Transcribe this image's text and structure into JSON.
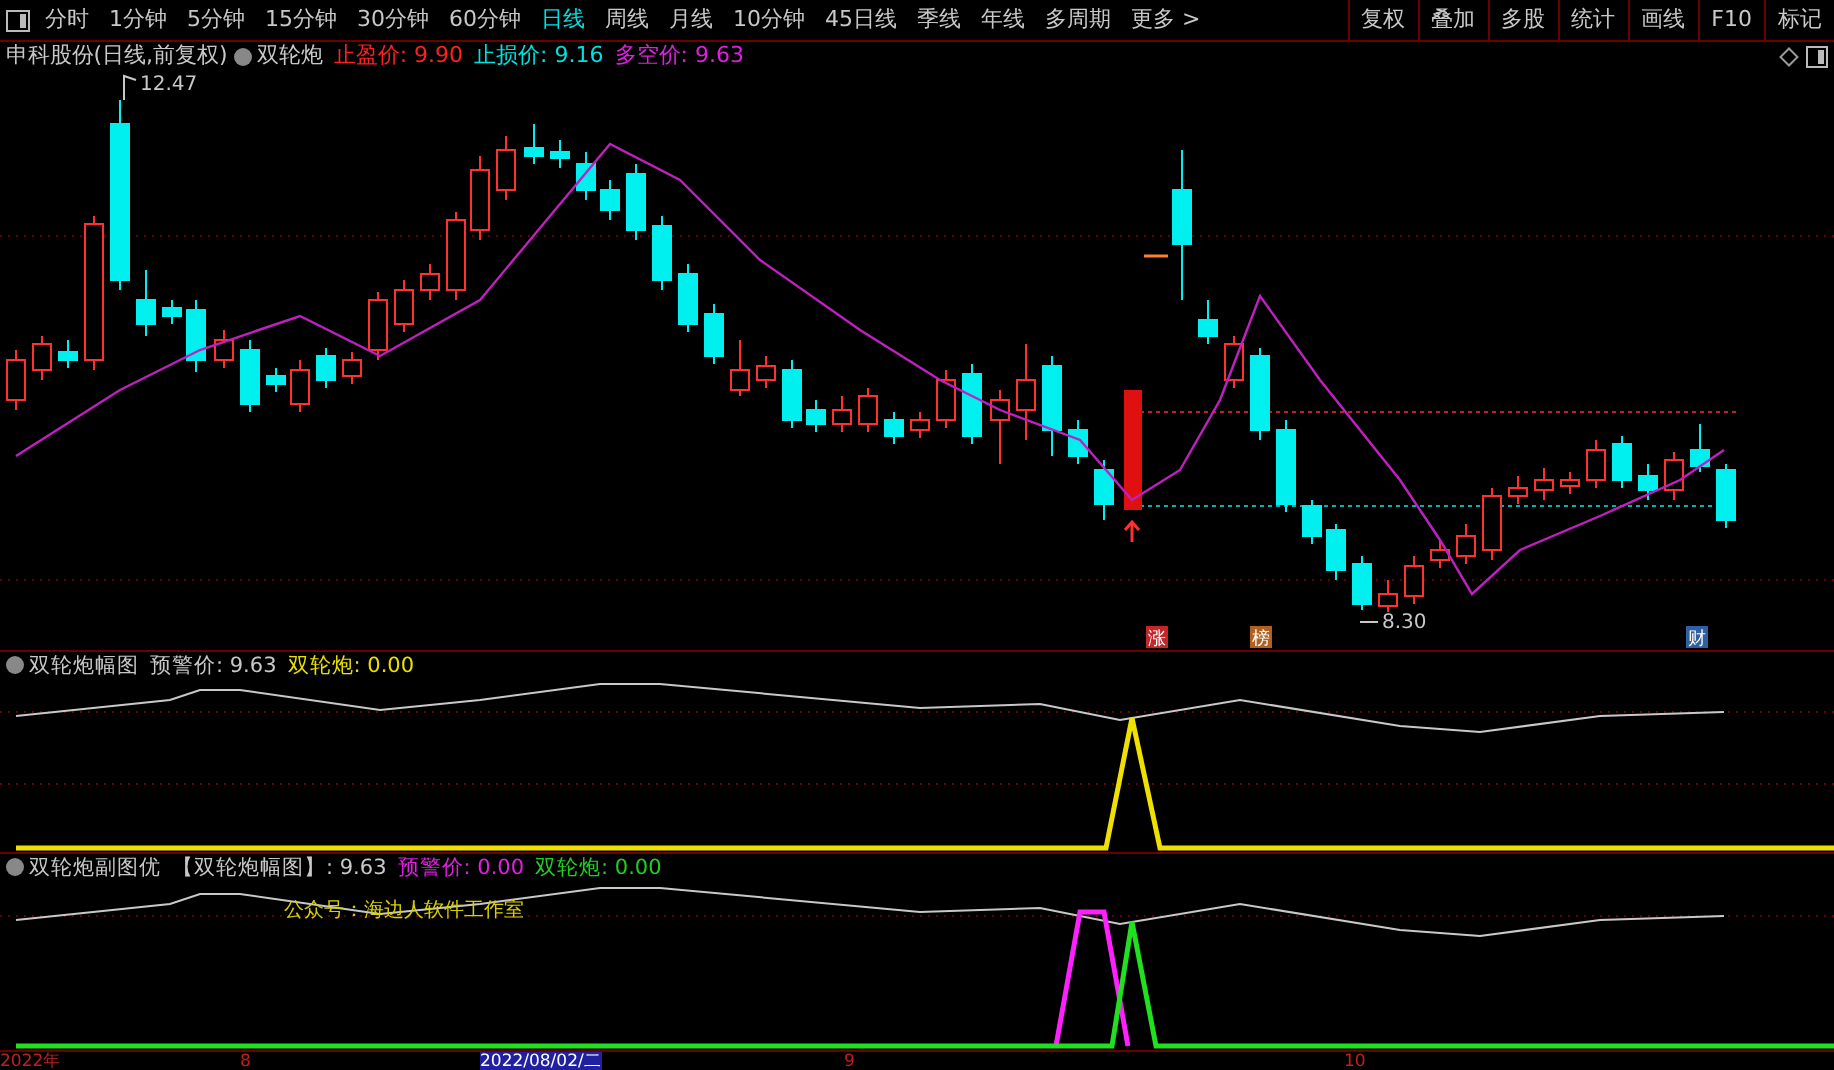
{
  "toolbar": {
    "periods": [
      {
        "label": "分时",
        "selected": false
      },
      {
        "label": "1分钟",
        "selected": false
      },
      {
        "label": "5分钟",
        "selected": false
      },
      {
        "label": "15分钟",
        "selected": false
      },
      {
        "label": "30分钟",
        "selected": false
      },
      {
        "label": "60分钟",
        "selected": false
      },
      {
        "label": "日线",
        "selected": true
      },
      {
        "label": "周线",
        "selected": false
      },
      {
        "label": "月线",
        "selected": false
      },
      {
        "label": "10分钟",
        "selected": false
      },
      {
        "label": "45日线",
        "selected": false
      },
      {
        "label": "季线",
        "selected": false
      },
      {
        "label": "年线",
        "selected": false
      },
      {
        "label": "多周期",
        "selected": false
      }
    ],
    "more": "更多 >",
    "buttons": [
      "复权",
      "叠加",
      "多股",
      "统计",
      "画线",
      "F10",
      "标记"
    ]
  },
  "main_chart": {
    "title": "申科股份(日线,前复权)",
    "indicator": "双轮炮",
    "legend": [
      {
        "label": "止盈价: 9.90",
        "color": "#ff2020"
      },
      {
        "label": "止损价: 9.16",
        "color": "#00e0e0"
      },
      {
        "label": "多空价: 9.63",
        "color": "#e020e0"
      }
    ],
    "high_label": "12.47",
    "low_label": "8.30",
    "badges": [
      {
        "label": "涨",
        "color": "#c0282c"
      },
      {
        "label": "榜",
        "color": "#b06020"
      },
      {
        "label": "财",
        "color": "#3060a0"
      }
    ]
  },
  "panel_1": {
    "title": "双轮炮幅图",
    "legend": [
      {
        "label": "预警价: 9.63",
        "color": "#c8c8c8"
      },
      {
        "label": "双轮炮: 0.00",
        "color": "#e8e000"
      }
    ]
  },
  "panel_2": {
    "title": "双轮炮副图优",
    "legend": [
      {
        "label": "【双轮炮幅图】: 9.63",
        "color": "#c8c8c8"
      },
      {
        "label": "预警价: 0.00",
        "color": "#e020e0"
      },
      {
        "label": "双轮炮: 0.00",
        "color": "#20d020"
      }
    ],
    "note": "公众号：海边人软件工作室"
  },
  "axis_labels": [
    {
      "label": "2022年",
      "selected": false
    },
    {
      "label": "8",
      "selected": false
    },
    {
      "label": "2022/08/02/二",
      "selected": true
    },
    {
      "label": "9",
      "selected": false
    },
    {
      "label": "10",
      "selected": false
    }
  ]
}
